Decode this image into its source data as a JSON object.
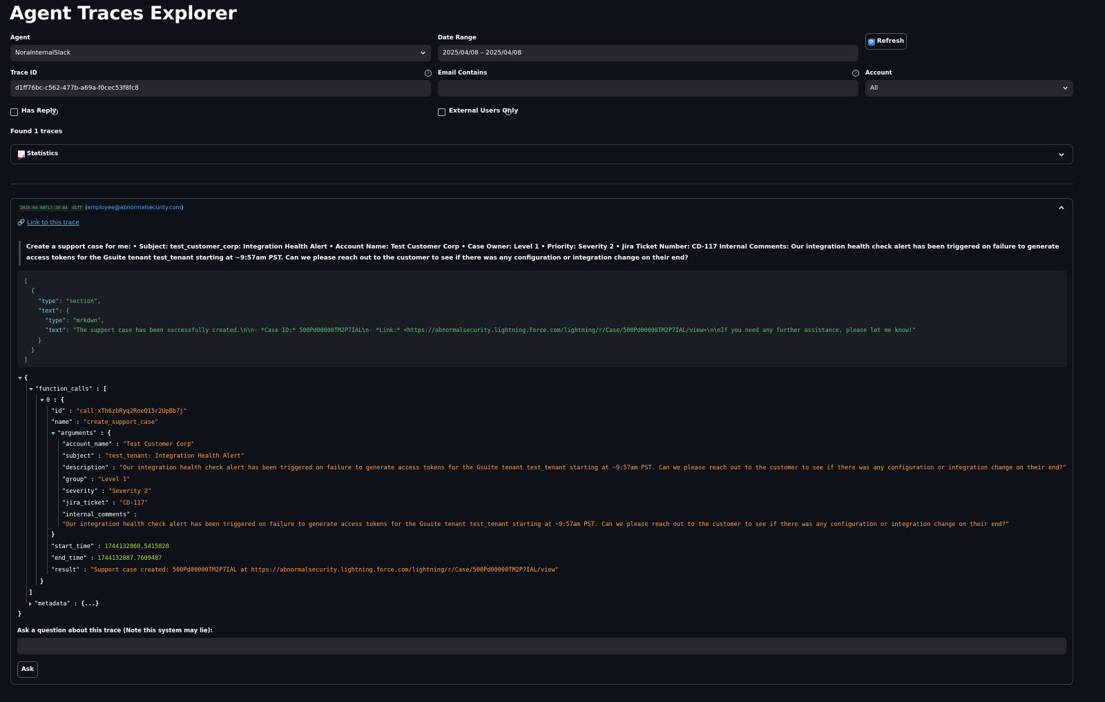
{
  "app": {
    "title": "Agent Traces Explorer"
  },
  "filters": {
    "agent_label": "Agent",
    "agent_value": "NoraInternalSlack",
    "date_label": "Date Range",
    "date_value": "2025/04/08 – 2025/04/08",
    "refresh_label": "Refresh",
    "trace_id_label": "Trace ID",
    "trace_id_value": "d1ff76bc-c562-477b-a69a-f0cec53f8fc8",
    "email_label": "Email Contains",
    "email_value": "",
    "account_label": "Account",
    "account_value": "All",
    "has_reply_label": "Has Reply",
    "external_label": "External Users Only"
  },
  "results": {
    "count_text": "Found 1 traces",
    "statistics_label": "Statistics",
    "statistics_icon": "chart-increasing-icon"
  },
  "trace": {
    "timestamp": "2025-04-08T17:20:44",
    "short_id": "d1ff",
    "email": "employee@abnormalsecurity.com",
    "link_text": "Link to this trace",
    "user_message": "Create a support case for me: • Subject: test_customer_corp: Integration Health Alert • Account Name: Test Customer Corp • Case Owner: Level 1 • Priority: Severity 2 • Jira Ticket Number: CD-117 Internal Comments: Our integration health check alert has been triggered on failure to generate access tokens for the Gsuite tenant test_tenant starting at ~9:57am PST. Can we please reach out to the customer to see if there was any configuration or integration change on their end?",
    "response": {
      "type_key": "\"type\"",
      "type_val": "\"section\"",
      "text_key": "\"text\"",
      "inner_type_val": "\"mrkdwn\"",
      "inner_text_val": "\"The support case has been successfully created.\\n\\n- *Case ID:* 500Pd00000TM2P7IAL\\n- *Link:* <https://abnormalsecurity.lightning.force.com/lightning/r/Case/500Pd00000TM2P7IAL/view>\\n\\nIf you need any further assistance, please let me know!\""
    },
    "json": {
      "function_calls_key": "\"function_calls\"",
      "index": "0",
      "id_key": "\"id\"",
      "id_val": "\"call_xTh6zbRyq2RoeQ15r2UpBb7j\"",
      "name_key": "\"name\"",
      "name_val": "\"create_support_case\"",
      "arguments_key": "\"arguments\"",
      "account_name_key": "\"account_name\"",
      "account_name_val": "\"Test Customer Corp\"",
      "subject_key": "\"subject\"",
      "subject_val": "\"test_tenant: Integration Health Alert\"",
      "description_key": "\"description\"",
      "description_val": "\"Our integration health check alert has been triggered on failure to generate access tokens for the Gsuite tenant test_tenant starting at ~9:57am PST. Can we please reach out to the customer to see if there was any configuration or integration change on their end?\"",
      "group_key": "\"group\"",
      "group_val": "\"Level 1\"",
      "severity_key": "\"severity\"",
      "severity_val": "\"Severity 2\"",
      "jira_key": "\"jira_ticket\"",
      "jira_val": "\"CD-117\"",
      "internal_key": "\"internal_comments\"",
      "internal_val": "\"Our integration health check alert has been triggered on failure to generate access tokens for the Gsuite tenant test_tenant starting at ~9:57am PST. Can we please reach out to the customer to see if there was any configuration or integration change on their end?\"",
      "start_key": "\"start_time\"",
      "start_val": "1744132860.5415828",
      "end_key": "\"end_time\"",
      "end_val": "1744132887.7609487",
      "result_key": "\"result\"",
      "result_val": "\"Support case created: 500Pd00000TM2P7IAL at https://abnormalsecurity.lightning.force.com/lightning/r/Case/500Pd00000TM2P7IAL/view\"",
      "metadata_key": "\"metadata\"",
      "metadata_val": "{...}"
    },
    "question_label": "Ask a question about this trace (Note this system may lie):",
    "question_value": "",
    "ask_label": "Ask"
  }
}
